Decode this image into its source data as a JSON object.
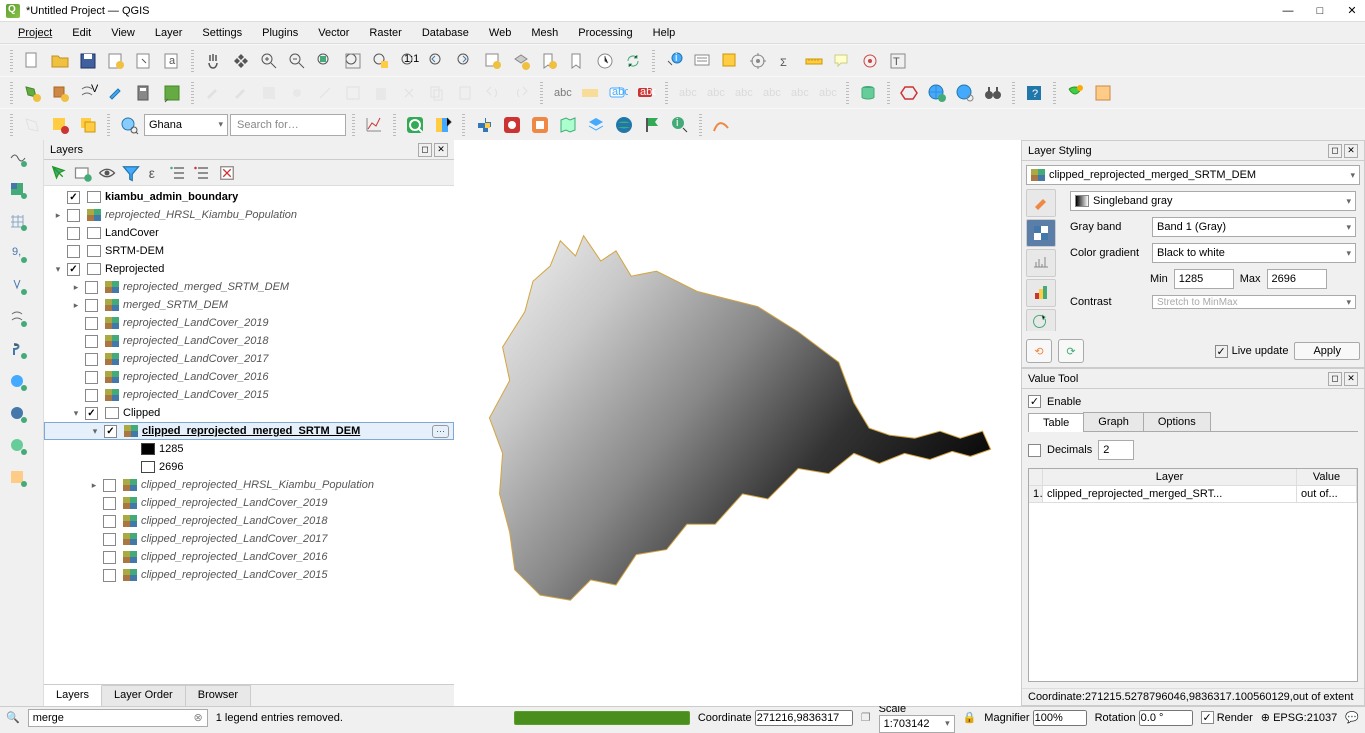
{
  "window": {
    "title": "*Untitled Project — QGIS"
  },
  "menu": {
    "items": [
      "Project",
      "Edit",
      "View",
      "Layer",
      "Settings",
      "Plugins",
      "Vector",
      "Raster",
      "Database",
      "Web",
      "Mesh",
      "Processing",
      "Help"
    ]
  },
  "locator": {
    "value": "merge"
  },
  "legend_msg": {
    "text": "1 legend entries removed."
  },
  "ghana": {
    "value": "Ghana"
  },
  "search": {
    "placeholder": "Search for…"
  },
  "layers_panel": {
    "title": "Layers",
    "tabs": [
      "Layers",
      "Layer Order",
      "Browser"
    ],
    "tree": [
      {
        "depth": 0,
        "exp": "",
        "chk": true,
        "icon": "poly",
        "label": "kiambu_admin_boundary",
        "style": "bold"
      },
      {
        "depth": 0,
        "exp": "▸",
        "chk": false,
        "icon": "raster",
        "label": "reprojected_HRSL_Kiambu_Population",
        "style": "italic"
      },
      {
        "depth": 0,
        "exp": "",
        "chk": false,
        "icon": "group",
        "label": "LandCover",
        "style": "normal"
      },
      {
        "depth": 0,
        "exp": "",
        "chk": false,
        "icon": "group",
        "label": "SRTM-DEM",
        "style": "normal"
      },
      {
        "depth": 0,
        "exp": "▾",
        "chk": true,
        "icon": "group",
        "label": "Reprojected",
        "style": "normal"
      },
      {
        "depth": 1,
        "exp": "▸",
        "chk": false,
        "icon": "raster",
        "label": "reprojected_merged_SRTM_DEM",
        "style": "italic"
      },
      {
        "depth": 1,
        "exp": "▸",
        "chk": false,
        "icon": "raster",
        "label": "merged_SRTM_DEM",
        "style": "italic"
      },
      {
        "depth": 1,
        "exp": "",
        "chk": false,
        "icon": "raster",
        "label": "reprojected_LandCover_2019",
        "style": "italic"
      },
      {
        "depth": 1,
        "exp": "",
        "chk": false,
        "icon": "raster",
        "label": "reprojected_LandCover_2018",
        "style": "italic"
      },
      {
        "depth": 1,
        "exp": "",
        "chk": false,
        "icon": "raster",
        "label": "reprojected_LandCover_2017",
        "style": "italic"
      },
      {
        "depth": 1,
        "exp": "",
        "chk": false,
        "icon": "raster",
        "label": "reprojected_LandCover_2016",
        "style": "italic"
      },
      {
        "depth": 1,
        "exp": "",
        "chk": false,
        "icon": "raster",
        "label": "reprojected_LandCover_2015",
        "style": "italic"
      },
      {
        "depth": 1,
        "exp": "▾",
        "chk": true,
        "icon": "group",
        "label": "Clipped",
        "style": "normal"
      },
      {
        "depth": 2,
        "exp": "▾",
        "chk": true,
        "icon": "raster",
        "label": "clipped_reprojected_merged_SRTM_DEM",
        "style": "underline",
        "selected": true,
        "filter": true
      },
      {
        "depth": 3,
        "exp": "",
        "chk": null,
        "icon": "swatch-black",
        "label": "1285",
        "style": "normal"
      },
      {
        "depth": 3,
        "exp": "",
        "chk": null,
        "icon": "swatch-white",
        "label": "2696",
        "style": "normal"
      },
      {
        "depth": 2,
        "exp": "▸",
        "chk": false,
        "icon": "raster",
        "label": "clipped_reprojected_HRSL_Kiambu_Population",
        "style": "italic"
      },
      {
        "depth": 2,
        "exp": "",
        "chk": false,
        "icon": "raster",
        "label": "clipped_reprojected_LandCover_2019",
        "style": "italic"
      },
      {
        "depth": 2,
        "exp": "",
        "chk": false,
        "icon": "raster",
        "label": "clipped_reprojected_LandCover_2018",
        "style": "italic"
      },
      {
        "depth": 2,
        "exp": "",
        "chk": false,
        "icon": "raster",
        "label": "clipped_reprojected_LandCover_2017",
        "style": "italic"
      },
      {
        "depth": 2,
        "exp": "",
        "chk": false,
        "icon": "raster",
        "label": "clipped_reprojected_LandCover_2016",
        "style": "italic"
      },
      {
        "depth": 2,
        "exp": "",
        "chk": false,
        "icon": "raster",
        "label": "clipped_reprojected_LandCover_2015",
        "style": "italic"
      }
    ]
  },
  "styling": {
    "title": "Layer Styling",
    "layer": "clipped_reprojected_merged_SRTM_DEM",
    "renderer": "Singleband gray",
    "gray_band_label": "Gray band",
    "gray_band": "Band 1 (Gray)",
    "color_gradient_label": "Color gradient",
    "color_gradient": "Black to white",
    "min_label": "Min",
    "min": "1285",
    "max_label": "Max",
    "max": "2696",
    "contrast_label": "Contrast",
    "contrast": "Stretch to MinMax",
    "live_update": "Live update",
    "apply": "Apply"
  },
  "value_tool": {
    "title": "Value Tool",
    "enable": "Enable",
    "tabs": [
      "Table",
      "Graph",
      "Options"
    ],
    "decimals_label": "Decimals",
    "decimals": "2",
    "columns": [
      "",
      "Layer",
      "Value"
    ],
    "rows": [
      [
        "1",
        "clipped_reprojected_merged_SRT...",
        "out of..."
      ]
    ],
    "coord_line": "Coordinate:271215.5278796046,9836317.100560129,out of extent"
  },
  "status": {
    "coordinate_label": "Coordinate",
    "coordinate": "271216,9836317",
    "scale_label": "Scale",
    "scale": "1:703142",
    "magnifier_label": "Magnifier",
    "magnifier": "100%",
    "rotation_label": "Rotation",
    "rotation": "0.0 °",
    "render": "Render",
    "epsg": "EPSG:21037"
  }
}
